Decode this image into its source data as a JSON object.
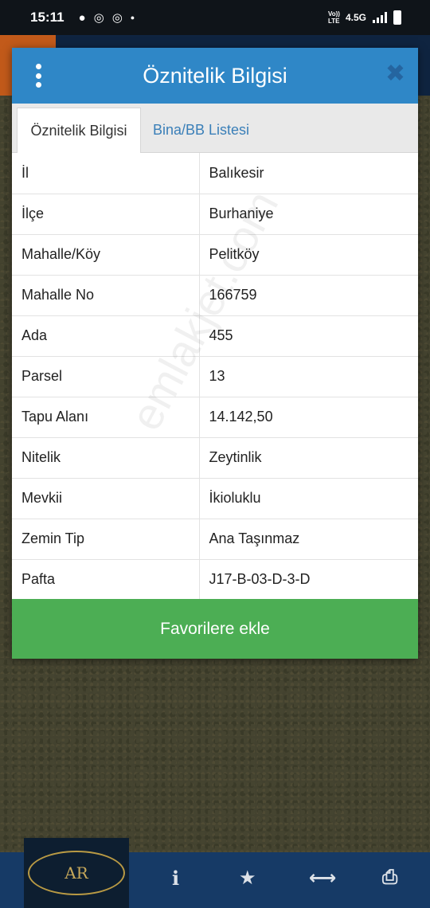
{
  "status_bar": {
    "time": "15:11",
    "network": "4.5G",
    "volte": "Vo)) LTE",
    "left_icons": [
      "message-icon",
      "instagram-icon",
      "instagram-icon",
      "dot-icon"
    ]
  },
  "dialog": {
    "title": "Öznitelik Bilgisi",
    "close_symbol": "✖",
    "tabs": [
      {
        "label": "Öznitelik Bilgisi",
        "active": true
      },
      {
        "label": "Bina/BB Listesi",
        "active": false
      }
    ],
    "rows": [
      {
        "key": "İl",
        "value": "Balıkesir"
      },
      {
        "key": "İlçe",
        "value": "Burhaniye"
      },
      {
        "key": "Mahalle/Köy",
        "value": "Pelitköy"
      },
      {
        "key": "Mahalle No",
        "value": "166759"
      },
      {
        "key": "Ada",
        "value": "455"
      },
      {
        "key": "Parsel",
        "value": "13"
      },
      {
        "key": "Tapu Alanı",
        "value": "14.142,50"
      },
      {
        "key": "Nitelik",
        "value": "Zeytinlik"
      },
      {
        "key": "Mevkii",
        "value": "İkioluklu"
      },
      {
        "key": "Zemin Tip",
        "value": "Ana Taşınmaz"
      },
      {
        "key": "Pafta",
        "value": "J17-B-03-D-3-D"
      }
    ],
    "favorite_button": "Favorilere ekle"
  },
  "watermark": "emlakjet.com",
  "bottom_nav": {
    "logo_text": "AR",
    "icons": [
      "info-icon",
      "star-icon",
      "measure-icon",
      "print-icon"
    ]
  },
  "colors": {
    "header_blue": "#2f87c7",
    "tab_link": "#3a7fb8",
    "favorite_green": "#4cae54",
    "nav_bg": "#163a66"
  }
}
